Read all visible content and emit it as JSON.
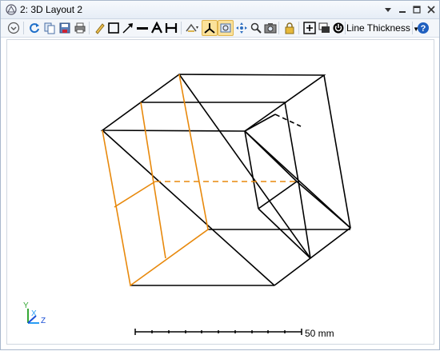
{
  "window": {
    "title": "2: 3D Layout 2",
    "icons": [
      "layout-window-icon",
      "dropdown-arrow-icon",
      "minimize-icon",
      "maximize-icon",
      "close-icon"
    ]
  },
  "toolbar": {
    "items": [
      "settings-dropdown-icon",
      "refresh-icon",
      "copy-icon",
      "save-icon",
      "print-icon",
      "pencil-icon",
      "rectangle-icon",
      "arrow-icon",
      "line-icon",
      "text-icon",
      "dimension-icon",
      "rotate-view-icon",
      "axis-view-icon",
      "zoom-window-icon",
      "pan-icon",
      "zoom-icon",
      "camera-icon",
      "lock-icon",
      "fit-icon",
      "layers-icon",
      "power-icon",
      "help-icon"
    ],
    "line_thickness_label": "Line Thickness",
    "active_tool": "axis-view-icon"
  },
  "colors": {
    "wire": "#000000",
    "highlight": "#e8890c",
    "axis_x": "#2a9df4",
    "axis_y": "#35a835",
    "axis_z": "#1a4fd6"
  },
  "axes": {
    "x_label": "X",
    "y_label": "Y",
    "z_label": "Z"
  },
  "scale_bar": {
    "label": "50 mm",
    "segments": 10
  }
}
